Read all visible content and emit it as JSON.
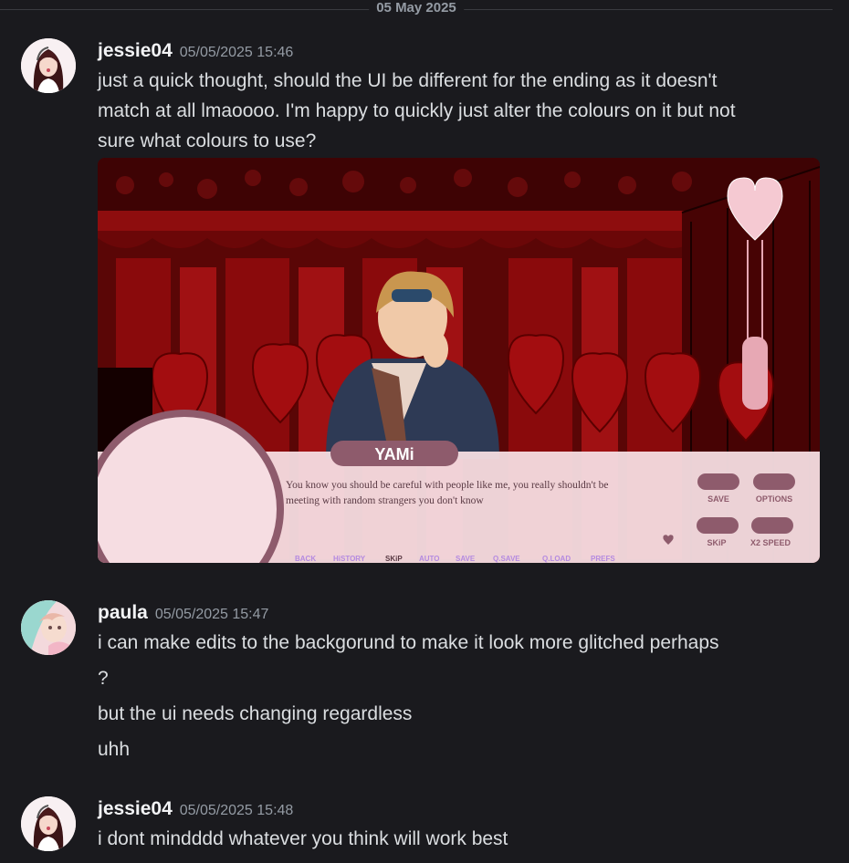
{
  "date_divider": "05 May 2025",
  "messages": [
    {
      "username": "jessie04",
      "timestamp": "05/05/2025 15:46",
      "lines": [
        "just a quick thought, should the UI be different for the ending as it doesn't",
        "match at all lmaoooo. I'm happy to quickly just alter the colours on it but not",
        "sure what colours to use?"
      ]
    },
    {
      "username": "paula",
      "timestamp": "05/05/2025 15:47",
      "lines": [
        "i can make edits to the backgorund to make it look more glitched perhaps",
        "?",
        "but the ui needs changing regardless",
        "uhh"
      ]
    },
    {
      "username": "jessie04",
      "timestamp": "05/05/2025 15:48",
      "lines": [
        "i dont mindddd whatever you think will work best"
      ]
    }
  ],
  "attachment": {
    "character_name": "YAMi",
    "dialogue_line1": "You know you should be careful with people like me, you really shouldn't be",
    "dialogue_line2": "meeting with random strangers you don't know",
    "buttons": {
      "save": "SAVE",
      "options": "OPTiONS",
      "skip": "SKiP",
      "speed": "X2 SPEED"
    },
    "quick_menu": [
      "BACK",
      "HiSTORY",
      "SKiP",
      "AUTO",
      "SAVE",
      "Q.SAVE",
      "Q.LOAD",
      "PREFS"
    ],
    "colors": {
      "background": "#5a0606",
      "ui_panel": "#f6dde2",
      "accent": "#8e5b6c"
    }
  }
}
